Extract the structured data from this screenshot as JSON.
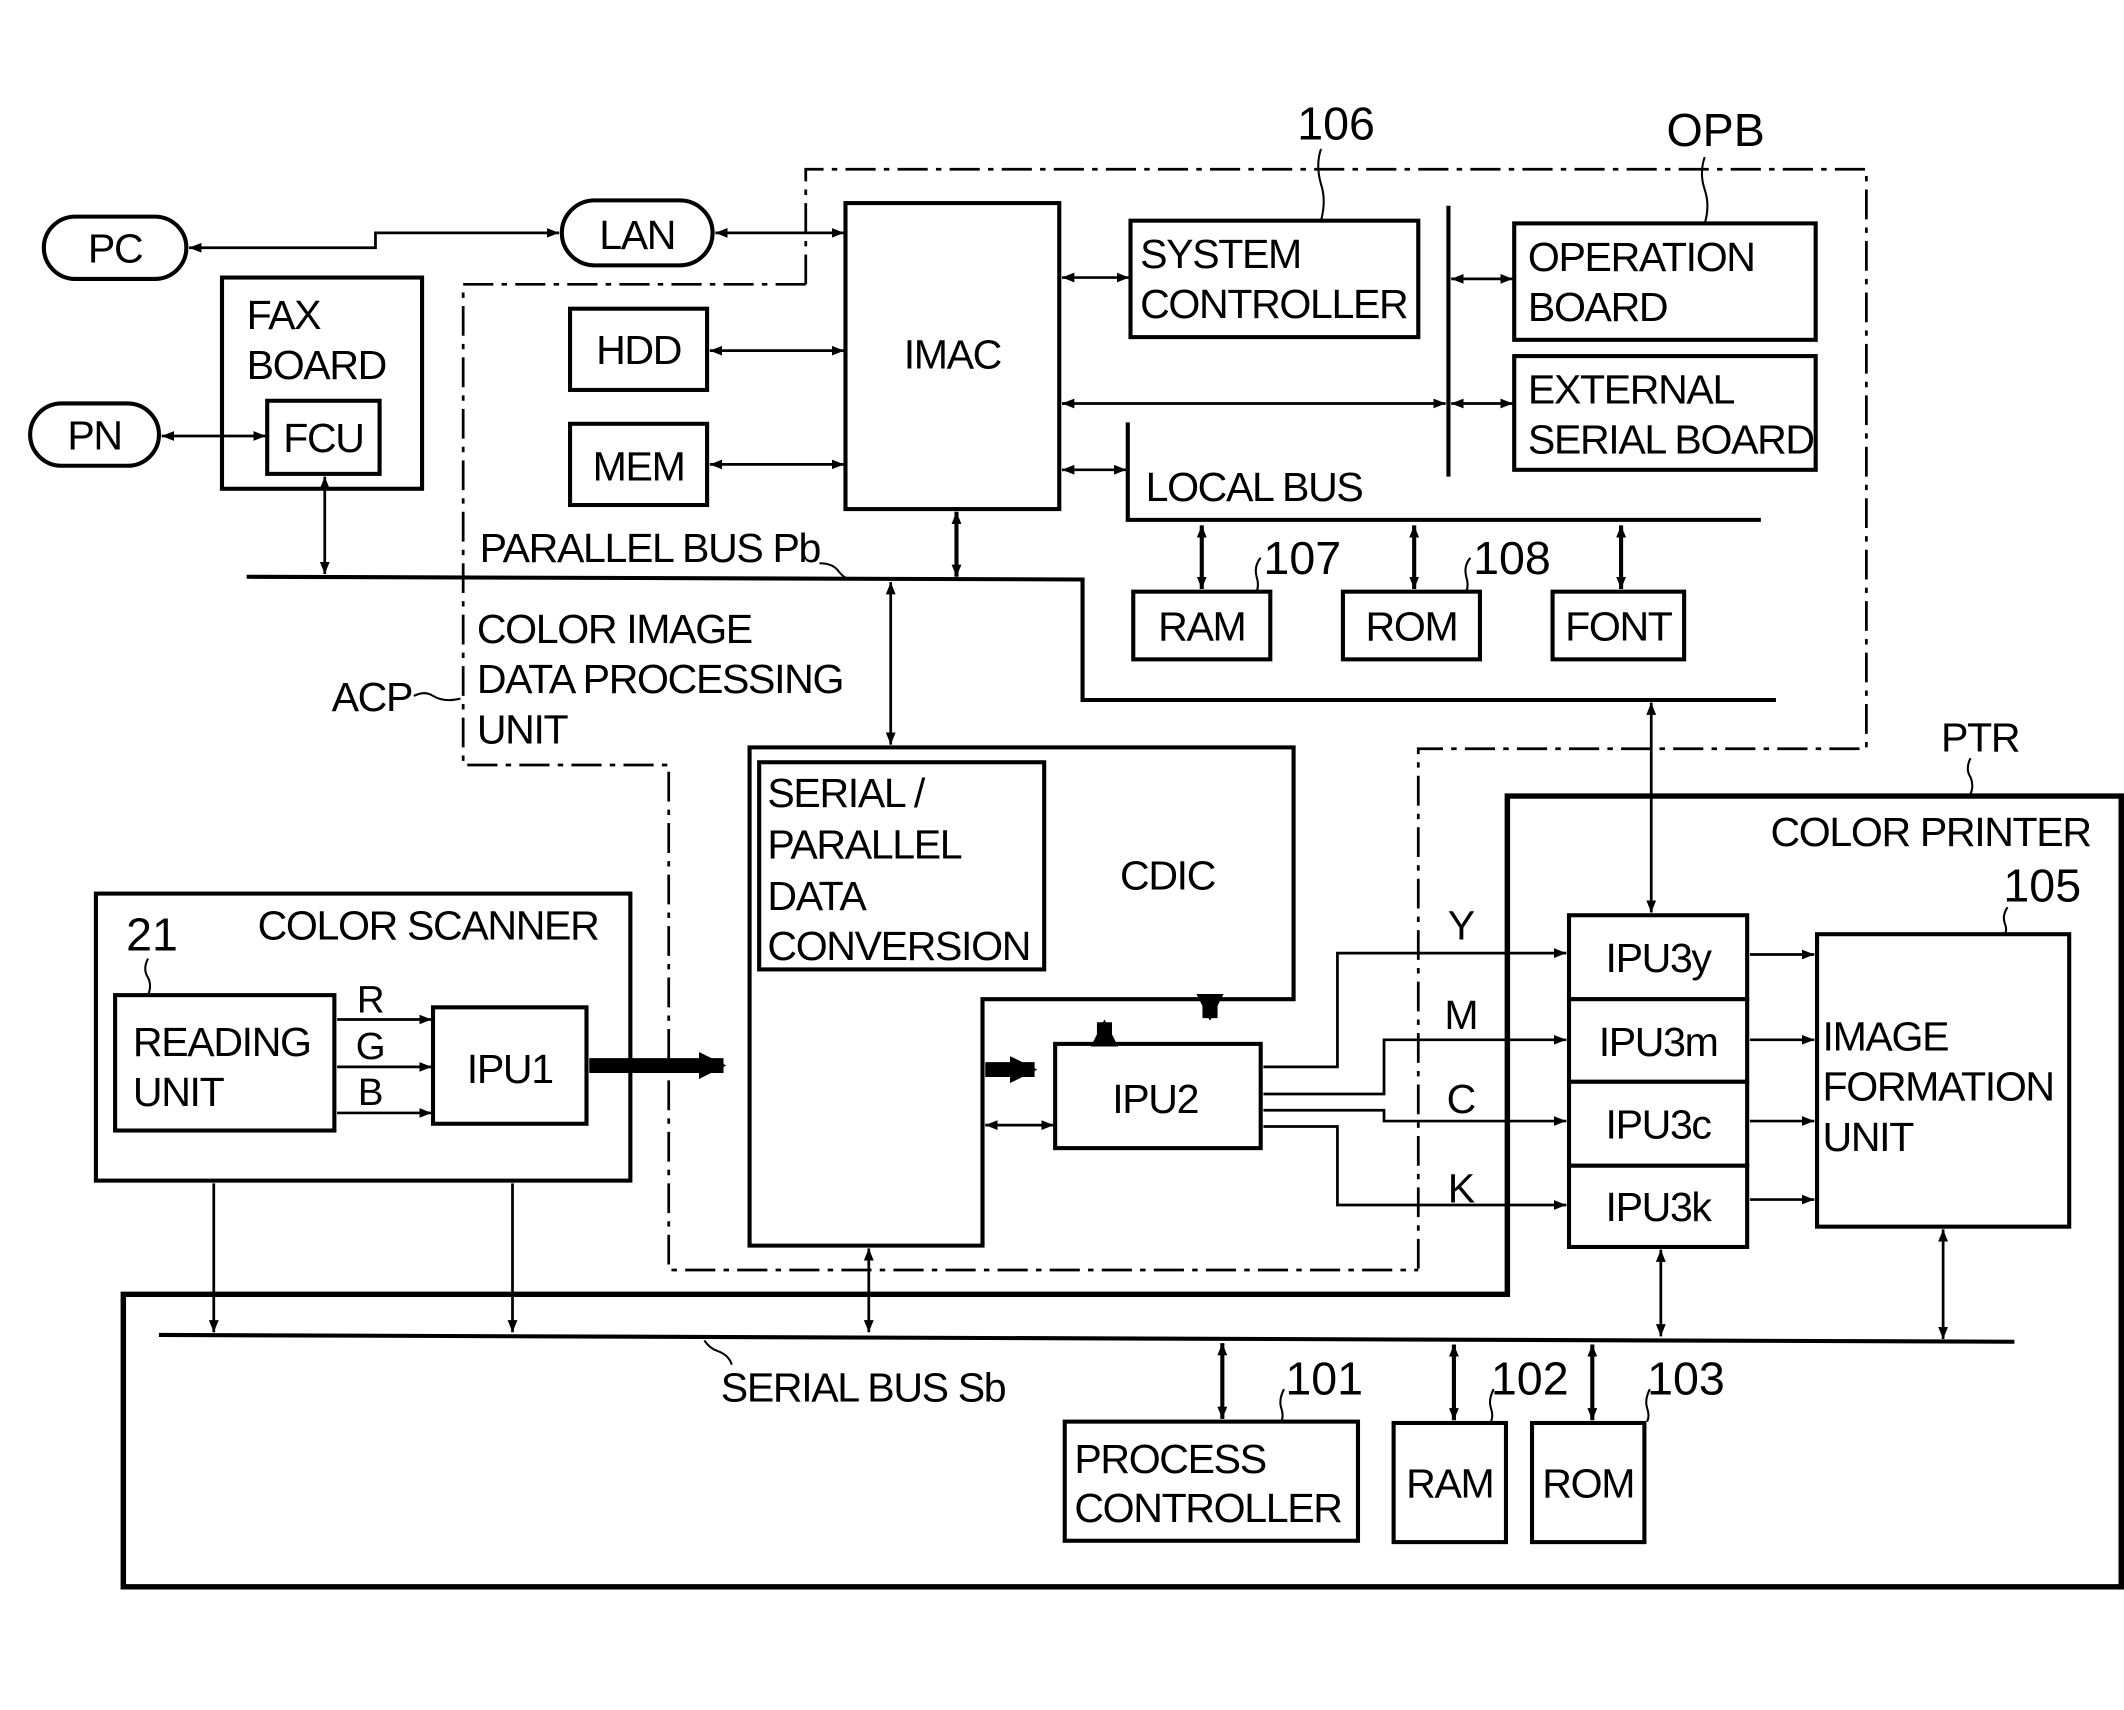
{
  "figure": {
    "external": {
      "pc": "PC",
      "lan": "LAN",
      "pn": "PN"
    },
    "fax_board": {
      "title_line1": "FAX",
      "title_line2": "BOARD",
      "fcu": "FCU"
    },
    "opb": {
      "ref": "OPB",
      "imac": "IMAC",
      "hdd": "HDD",
      "mem": "MEM",
      "system_controller": {
        "line1": "SYSTEM",
        "line2": "CONTROLLER",
        "ref": "106"
      },
      "operation_board": {
        "line1": "OPERATION",
        "line2": "BOARD"
      },
      "external_serial_board": {
        "line1": "EXTERNAL",
        "line2": "SERIAL BOARD"
      },
      "local_bus": "LOCAL BUS",
      "ram": {
        "label": "RAM",
        "ref": "107"
      },
      "rom": {
        "label": "ROM",
        "ref": "108"
      },
      "font": {
        "label": "FONT"
      }
    },
    "parallel_bus": "PARALLEL BUS Pb",
    "acp": {
      "ref": "ACP",
      "line1": "COLOR IMAGE",
      "line2": "DATA PROCESSING",
      "line3": "UNIT"
    },
    "cdic": {
      "label": "CDIC",
      "sp_line1": "SERIAL /",
      "sp_line2": "PARALLEL",
      "sp_line3": "DATA",
      "sp_line4": "CONVERSION",
      "ipu2": "IPU2"
    },
    "scanner": {
      "title": "COLOR SCANNER",
      "ref": "21",
      "reading_line1": "READING",
      "reading_line2": "UNIT",
      "ipu1": "IPU1",
      "channels": [
        "R",
        "G",
        "B"
      ]
    },
    "printer": {
      "ref": "PTR",
      "title": "COLOR PRINTER",
      "ipu3": [
        "IPU3y",
        "IPU3m",
        "IPU3c",
        "IPU3k"
      ],
      "color_channels": [
        "Y",
        "M",
        "C",
        "K"
      ],
      "image_formation": {
        "line1": "IMAGE",
        "line2": "FORMATION",
        "line3": "UNIT",
        "ref": "105"
      }
    },
    "serial_bus": "SERIAL BUS Sb",
    "process_controller": {
      "line1": "PROCESS",
      "line2": "CONTROLLER",
      "ref": "101"
    },
    "printer_ram": {
      "label": "RAM",
      "ref": "102"
    },
    "printer_rom": {
      "label": "ROM",
      "ref": "103"
    }
  }
}
